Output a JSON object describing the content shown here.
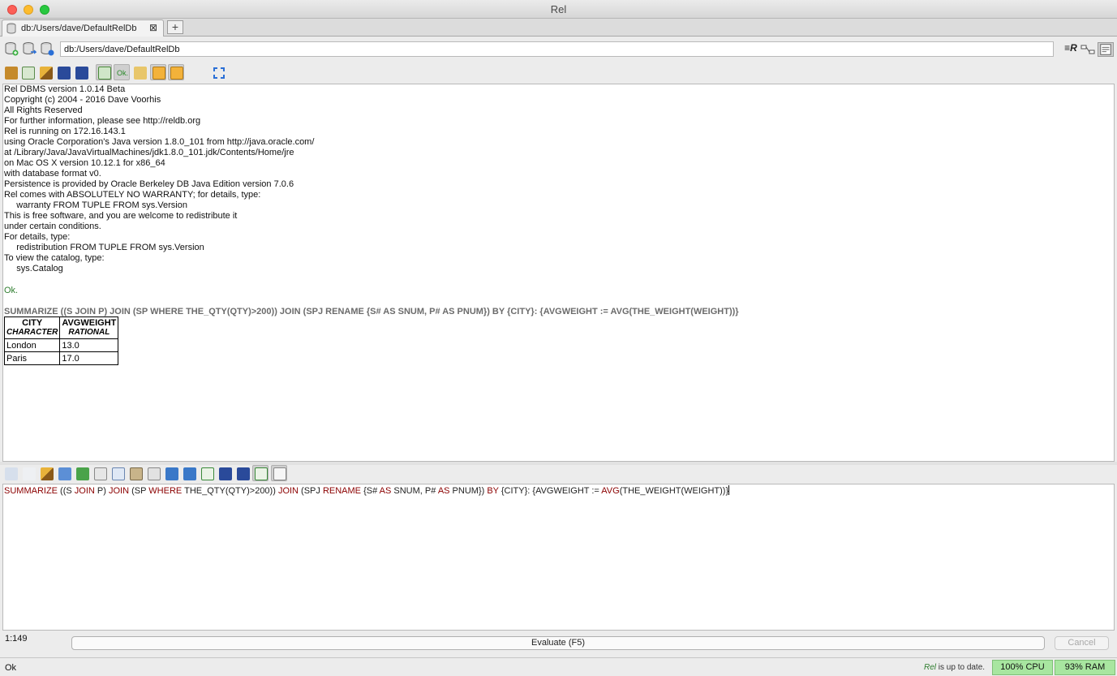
{
  "window": {
    "title": "Rel"
  },
  "tab": {
    "label": "db:/Users/dave/DefaultRelDb",
    "close_glyph": "⊠",
    "add_glyph": "+"
  },
  "pathbar": {
    "value": "db:/Users/dave/DefaultRelDb"
  },
  "output_toolbar": {
    "ok_toggle_label": "Ok."
  },
  "output": {
    "lines": [
      "Rel DBMS version 1.0.14 Beta",
      "Copyright (c) 2004 - 2016 Dave Voorhis",
      "All Rights Reserved",
      "For further information, please see http://reldb.org",
      "Rel is running on 172.16.143.1",
      "using Oracle Corporation's Java version 1.8.0_101 from http://java.oracle.com/",
      "at /Library/Java/JavaVirtualMachines/jdk1.8.0_101.jdk/Contents/Home/jre",
      "on Mac OS X version 10.12.1 for x86_64",
      "with database format v0.",
      "Persistence is provided by Oracle Berkeley DB Java Edition version 7.0.6",
      "Rel comes with ABSOLUTELY NO WARRANTY; for details, type:",
      "     warranty FROM TUPLE FROM sys.Version",
      "This is free software, and you are welcome to redistribute it",
      "under certain conditions.",
      "For details, type:",
      "     redistribution FROM TUPLE FROM sys.Version",
      "To view the catalog, type:",
      "     sys.Catalog"
    ],
    "ok": "Ok.",
    "query": "SUMMARIZE ((S JOIN P) JOIN (SP WHERE THE_QTY(QTY)>200)) JOIN (SPJ RENAME {S# AS SNUM, P# AS PNUM}) BY {CITY}: {AVGWEIGHT := AVG(THE_WEIGHT(WEIGHT))}",
    "result": {
      "headers": [
        {
          "name": "CITY",
          "type": "CHARACTER"
        },
        {
          "name": "AVGWEIGHT",
          "type": "RATIONAL"
        }
      ],
      "rows": [
        [
          "London",
          "13.0"
        ],
        [
          "Paris",
          "17.0"
        ]
      ]
    }
  },
  "input": {
    "code": [
      {
        "t": "SUMMARIZE",
        "kw": true
      },
      {
        "t": " ((S ",
        "kw": false
      },
      {
        "t": "JOIN",
        "kw": true
      },
      {
        "t": " P) ",
        "kw": false
      },
      {
        "t": "JOIN",
        "kw": true
      },
      {
        "t": " (SP ",
        "kw": false
      },
      {
        "t": "WHERE",
        "kw": true
      },
      {
        "t": " THE_QTY(QTY)>200)) ",
        "kw": false
      },
      {
        "t": "JOIN",
        "kw": true
      },
      {
        "t": " (SPJ ",
        "kw": false
      },
      {
        "t": "RENAME",
        "kw": true
      },
      {
        "t": " {S# ",
        "kw": false
      },
      {
        "t": "AS",
        "kw": true
      },
      {
        "t": " SNUM, P# ",
        "kw": false
      },
      {
        "t": "AS",
        "kw": true
      },
      {
        "t": " PNUM}) ",
        "kw": false
      },
      {
        "t": "BY",
        "kw": true
      },
      {
        "t": " {CITY}: {AVGWEIGHT := ",
        "kw": false
      },
      {
        "t": "AVG",
        "kw": true
      },
      {
        "t": "(THE_WEIGHT(WEIGHT))}",
        "kw": false
      }
    ]
  },
  "editor_status": {
    "position": "1:149"
  },
  "buttons": {
    "evaluate": "Evaluate (F5)",
    "cancel": "Cancel"
  },
  "status": {
    "text": "Ok",
    "update_name": "Rel",
    "update_text": " is up to date.",
    "cpu": "100% CPU",
    "ram": "93% RAM"
  },
  "colors": {
    "keyword": "#8b0000",
    "ok": "#2e7d2e",
    "meter": "#a8e6a0"
  }
}
